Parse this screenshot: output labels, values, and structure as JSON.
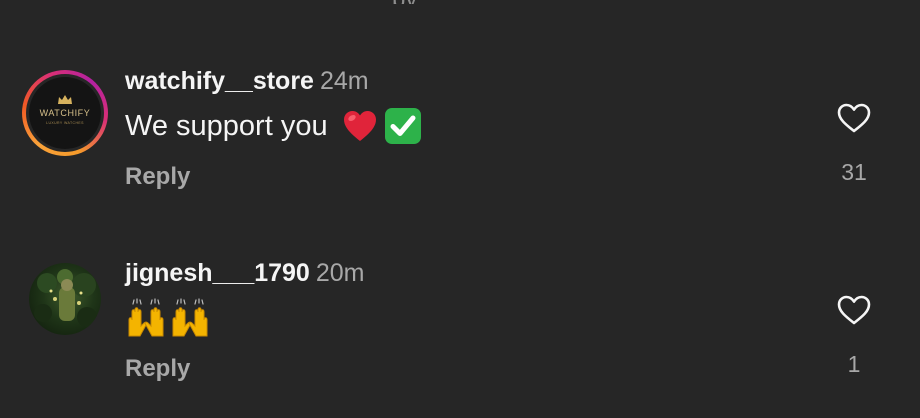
{
  "comments": [
    {
      "username": "watchify__store",
      "time": "24m",
      "text": "We support you",
      "emojis": [
        "red-heart",
        "check-mark-button"
      ],
      "reply_label": "Reply",
      "like_count": "31",
      "avatar": {
        "logo_text": "WATCHIFY",
        "logo_subtext": "LUXURY WATCHES"
      }
    },
    {
      "username": "jignesh___1790",
      "time": "20m",
      "text": "",
      "emojis": [
        "raising-hands",
        "raising-hands"
      ],
      "reply_label": "Reply",
      "like_count": "1"
    }
  ],
  "colors": {
    "background": "#262626",
    "primary_text": "#f5f5f5",
    "secondary_text": "#a8a8a8",
    "heart_red": "#e0243a",
    "check_green": "#2db24a"
  }
}
